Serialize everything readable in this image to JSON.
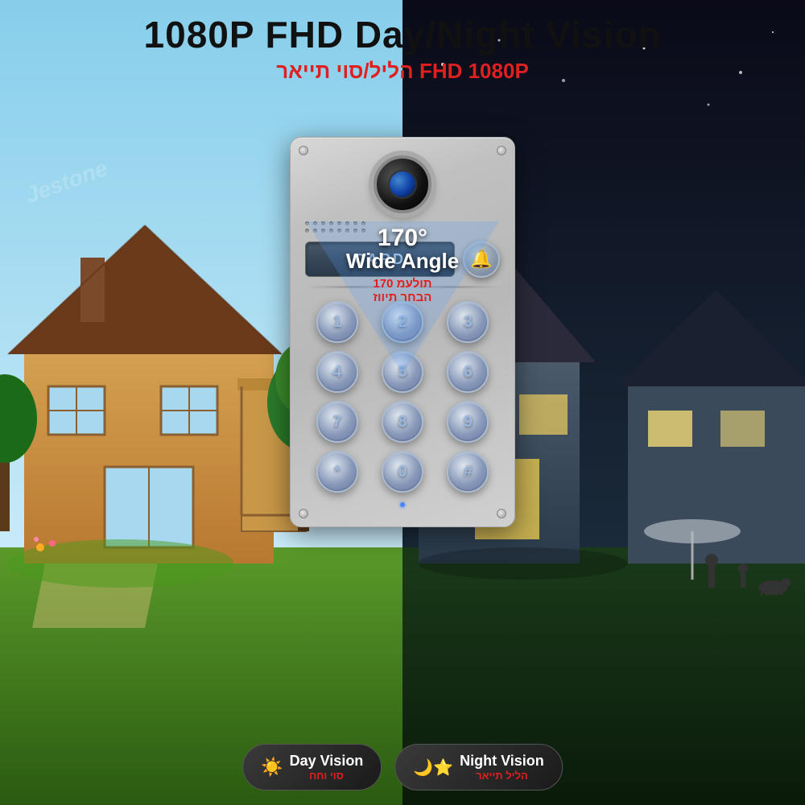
{
  "header": {
    "title_main": "1080P FHD Day/Night Vision",
    "title_hebrew": "הליל/סוי תייאר FHD 1080P"
  },
  "angle": {
    "degrees": "170°",
    "label": "Wide Angle",
    "hebrew_line1": "תולעמ 170",
    "hebrew_line2": "הבחר תיווז"
  },
  "card_reader": {
    "label": "CARD"
  },
  "keypad": {
    "keys": [
      "1",
      "2",
      "3",
      "4",
      "5",
      "6",
      "7",
      "8",
      "9",
      "*",
      "0",
      "#"
    ]
  },
  "badges": {
    "day": {
      "main": "Day Vision",
      "sub": "סוי וחח",
      "icon": "☀"
    },
    "night": {
      "main": "Night Vision",
      "sub": "הליל תייאר",
      "icon": "☽★"
    }
  },
  "watermark": "Jestone"
}
